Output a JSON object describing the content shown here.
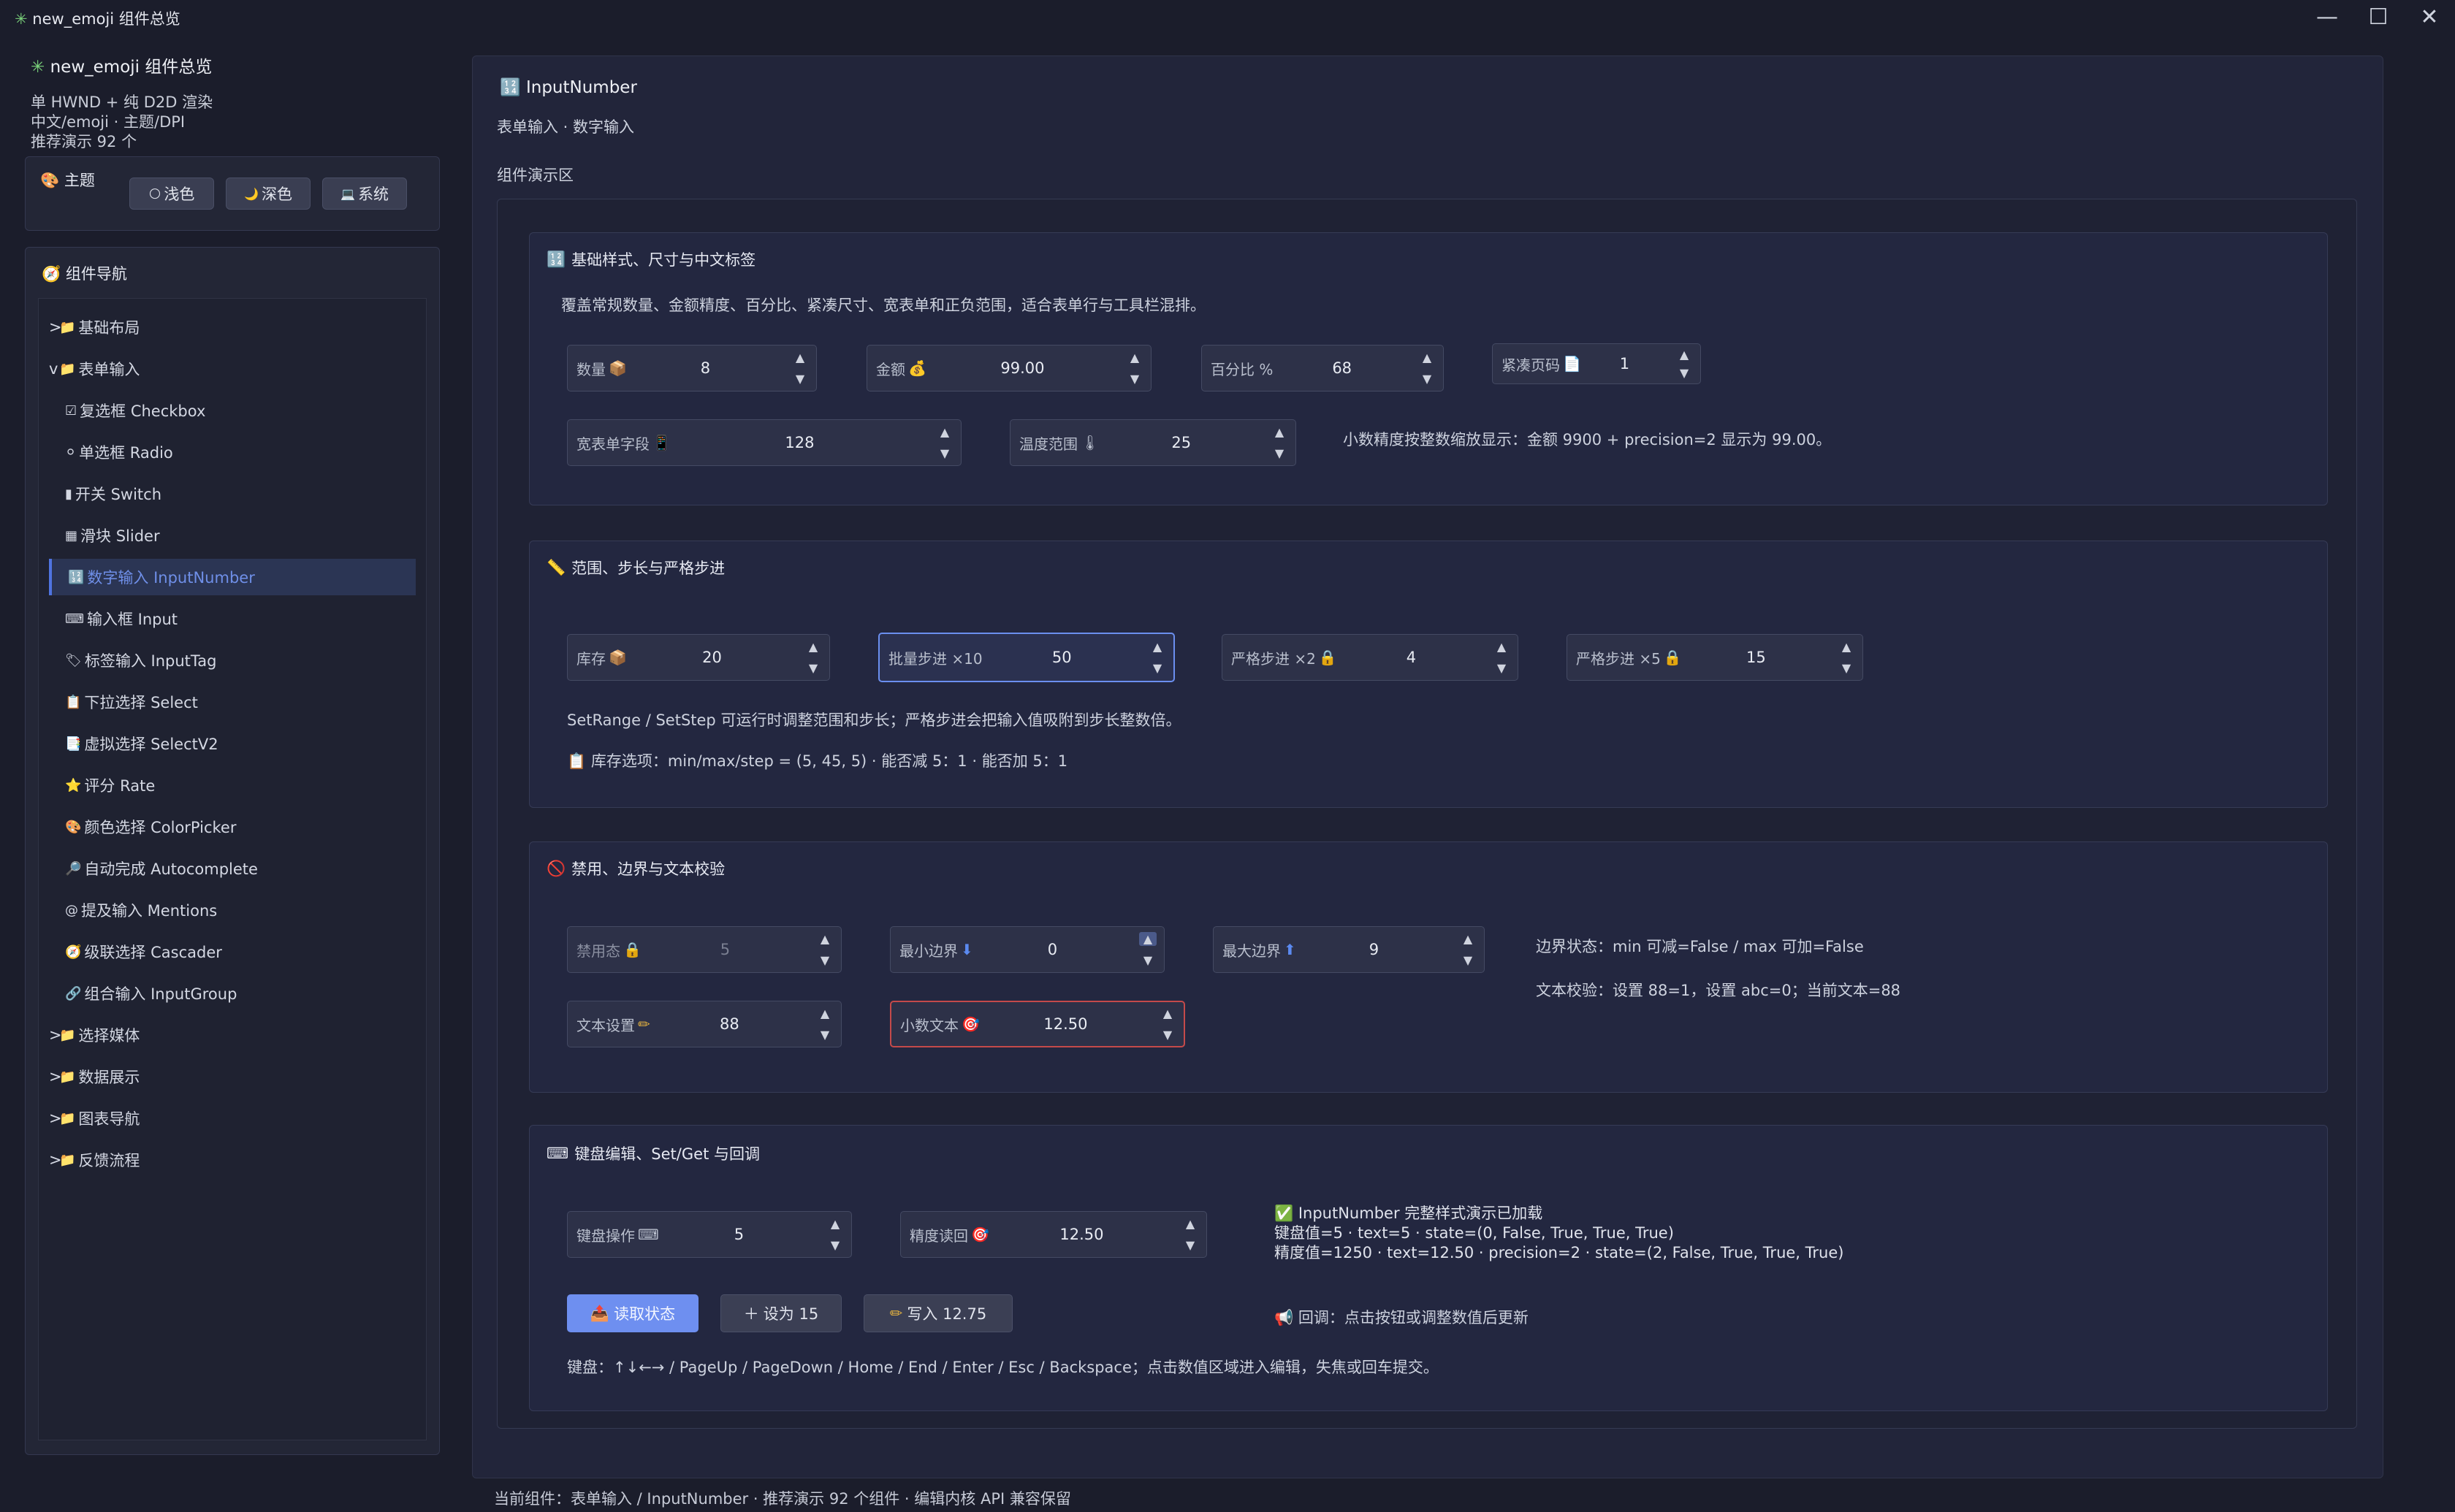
{
  "window": {
    "title": "new_emoji 组件总览",
    "icon": "✳"
  },
  "sidebar": {
    "app_title": "new_emoji 组件总览",
    "sub_lines": [
      "单 HWND + 纯 D2D 渲染",
      "中文/emoji · 主题/DPI",
      "推荐演示 92 个"
    ],
    "theme": {
      "label": "主题",
      "buttons": [
        {
          "icon": "🌕",
          "label": "浅色"
        },
        {
          "icon": "🌙",
          "label": "深色"
        },
        {
          "icon": "💻",
          "label": "系统"
        }
      ]
    },
    "nav_title": "组件导航",
    "items": [
      {
        "prefix": ">",
        "icon": "📁",
        "label": "基础布局"
      },
      {
        "prefix": "v",
        "icon": "📁",
        "label": "表单输入"
      },
      {
        "prefix": "",
        "icon": "☑",
        "label": "复选框 Checkbox"
      },
      {
        "prefix": "",
        "icon": "⚪",
        "label": "单选框 Radio"
      },
      {
        "prefix": "",
        "icon": "▮",
        "label": "开关 Switch"
      },
      {
        "prefix": "",
        "icon": "▦",
        "label": "滑块 Slider"
      },
      {
        "prefix": "",
        "icon": "🔢",
        "label": "数字输入 InputNumber"
      },
      {
        "prefix": "",
        "icon": "⌨",
        "label": "输入框 Input"
      },
      {
        "prefix": "",
        "icon": "🏷",
        "label": "标签输入 InputTag"
      },
      {
        "prefix": "",
        "icon": "📋",
        "label": "下拉选择 Select"
      },
      {
        "prefix": "",
        "icon": "📑",
        "label": "虚拟选择 SelectV2"
      },
      {
        "prefix": "",
        "icon": "⭐",
        "label": "评分 Rate"
      },
      {
        "prefix": "",
        "icon": "🎨",
        "label": "颜色选择 ColorPicker"
      },
      {
        "prefix": "",
        "icon": "🔎",
        "label": "自动完成 Autocomplete"
      },
      {
        "prefix": "",
        "icon": "@",
        "label": "提及输入 Mentions"
      },
      {
        "prefix": "",
        "icon": "🧭",
        "label": "级联选择 Cascader"
      },
      {
        "prefix": "",
        "icon": "🔗",
        "label": "组合输入 InputGroup"
      },
      {
        "prefix": ">",
        "icon": "📁",
        "label": "选择媒体"
      },
      {
        "prefix": ">",
        "icon": "📁",
        "label": "数据展示"
      },
      {
        "prefix": ">",
        "icon": "📁",
        "label": "图表导航"
      },
      {
        "prefix": ">",
        "icon": "📁",
        "label": "反馈流程"
      }
    ]
  },
  "main": {
    "title": "InputNumber",
    "subtitle": "表单输入 · 数字输入",
    "demo_label": "组件演示区",
    "section1": {
      "title": "基础样式、尺寸与中文标签",
      "desc": "覆盖常规数量、金额精度、百分比、紧凑尺寸、宽表单和正负范围，适合表单行与工具栏混排。",
      "fields": [
        {
          "label": "数量",
          "icon": "📦",
          "value": "8"
        },
        {
          "label": "金额",
          "icon": "💰",
          "value": "99.00"
        },
        {
          "label": "百分比 %",
          "icon": "",
          "value": "68"
        },
        {
          "label": "紧凑页码",
          "icon": "📄",
          "value": "1"
        },
        {
          "label": "宽表单字段",
          "icon": "📱",
          "value": "128"
        },
        {
          "label": "温度范围",
          "icon": "🌡",
          "value": "25"
        }
      ],
      "note": "小数精度按整数缩放显示：金额 9900 + precision=2 显示为 99.00。"
    },
    "section2": {
      "title": "范围、步长与严格步进",
      "fields": [
        {
          "label": "库存",
          "icon": "📦",
          "value": "20"
        },
        {
          "label": "批量步进 ×10",
          "icon": "",
          "value": "50"
        },
        {
          "label": "严格步进 ×2",
          "icon": "🔒",
          "value": "4"
        },
        {
          "label": "严格步进 ×5",
          "icon": "🔒",
          "value": "15"
        }
      ],
      "desc": "SetRange / SetStep 可运行时调整范围和步长；严格步进会把输入值吸附到步长整数倍。",
      "status": "库存选项：min/max/step = (5, 45, 5) · 能否减 5：1 · 能否加 5：1"
    },
    "section3": {
      "title": "禁用、边界与文本校验",
      "fields": [
        {
          "label": "禁用态",
          "icon": "🔒",
          "value": "5"
        },
        {
          "label": "最小边界",
          "icon": "⬇",
          "value": "0"
        },
        {
          "label": "最大边界",
          "icon": "⬆",
          "value": "9"
        },
        {
          "label": "文本设置",
          "icon": "✏",
          "value": "88"
        },
        {
          "label": "小数文本",
          "icon": "🎯",
          "value": "12.50"
        }
      ],
      "boundary_status": "边界状态：min 可减=False / max 可加=False",
      "text_check": "文本校验：设置 88=1，设置 abc=0；当前文本=88"
    },
    "section4": {
      "title": "键盘编辑、Set/Get 与回调",
      "fields": [
        {
          "label": "键盘操作",
          "icon": "⌨",
          "value": "5"
        },
        {
          "label": "精度读回",
          "icon": "🎯",
          "value": "12.50"
        }
      ],
      "info_lines": [
        "InputNumber 完整样式演示已加载",
        "键盘值=5 · text=5 · state=(0, False, True, True, True)",
        "精度值=1250 · text=12.50 · precision=2 · state=(2, False, True, True, True)"
      ],
      "buttons": [
        {
          "icon": "📤",
          "label": "读取状态"
        },
        {
          "icon": "＋",
          "label": "设为 15"
        },
        {
          "icon": "✏",
          "label": "写入 12.75"
        }
      ],
      "callback": "回调：点击按钮或调整数值后更新",
      "keyboard_help": "键盘：↑↓←→ / PageUp / PageDown / Home / End / Enter / Esc / Backspace；点击数值区域进入编辑，失焦或回车提交。"
    }
  },
  "statusbar": "当前组件：表单输入 / InputNumber · 推荐演示 92 个组件 · 编辑内核 API 兼容保留"
}
